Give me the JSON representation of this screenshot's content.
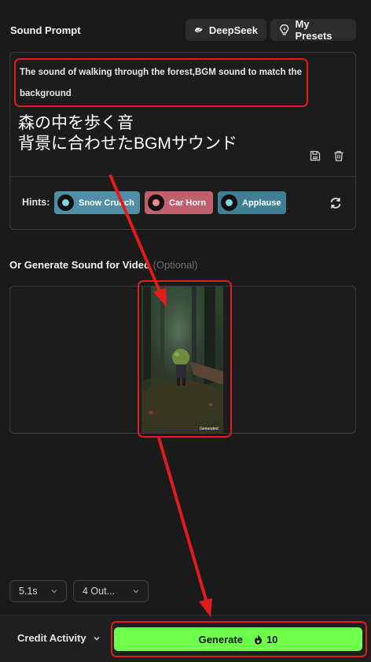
{
  "header": {
    "title": "Sound Prompt",
    "deepseek_label": "DeepSeek",
    "presets_label": "My Presets"
  },
  "prompt": {
    "text": "The sound of walking through the forest,BGM sound to match the background"
  },
  "annotation": {
    "jp_line1": "森の中を歩く音",
    "jp_line2": "背景に合わせたBGMサウンド",
    "color": "#e21b1b"
  },
  "hints": {
    "label": "Hints:",
    "chips": [
      {
        "label": "Snow Crunch",
        "bg": "#4f8fa8",
        "dot": "#7fd3ea"
      },
      {
        "label": "Car Horn",
        "bg": "#c0606c",
        "dot": "#f08a8a"
      },
      {
        "label": "Applause",
        "bg": "#3f7f95",
        "dot": "#7fd3ea"
      }
    ]
  },
  "video": {
    "title": "Or Generate Sound for Video",
    "optional": "(Optional)",
    "thumb_caption": "Generated"
  },
  "controls": {
    "duration": "5.1s",
    "outputs": "4 Out..."
  },
  "footer": {
    "credit_label": "Credit Activity",
    "generate_label": "Generate",
    "cost": "10",
    "accent": "#6eff4c"
  }
}
